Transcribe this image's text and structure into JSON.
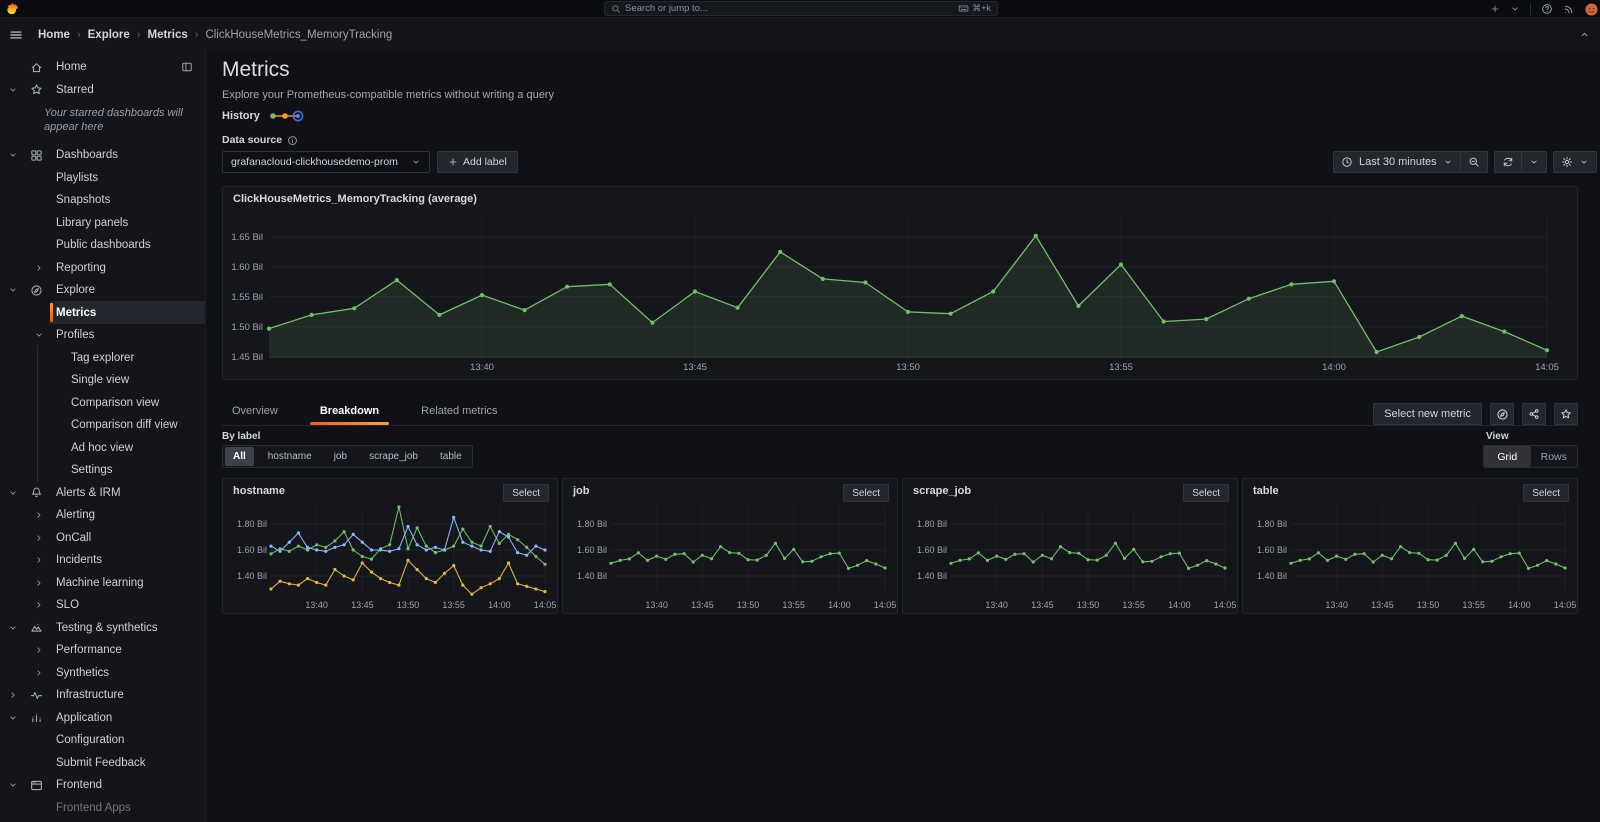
{
  "topbar": {
    "search_placeholder": "Search or jump to...",
    "shortcut": "⌘+k"
  },
  "breadcrumb": {
    "items": [
      "Home",
      "Explore",
      "Metrics"
    ],
    "current": "ClickHouseMetrics_MemoryTracking"
  },
  "sidebar": {
    "items": [
      {
        "label": "Home",
        "level": 0,
        "icon": "home",
        "trailing": "dock"
      },
      {
        "label": "Starred",
        "level": 0,
        "icon": "star",
        "chevron": "down"
      },
      {
        "type": "note",
        "text": "Your starred dashboards will appear here"
      },
      {
        "label": "Dashboards",
        "level": 0,
        "icon": "apps",
        "chevron": "down"
      },
      {
        "label": "Playlists",
        "level": 1
      },
      {
        "label": "Snapshots",
        "level": 1
      },
      {
        "label": "Library panels",
        "level": 1
      },
      {
        "label": "Public dashboards",
        "level": 1
      },
      {
        "label": "Reporting",
        "level": 1,
        "chevron": "right"
      },
      {
        "label": "Explore",
        "level": 0,
        "icon": "compass",
        "chevron": "down"
      },
      {
        "label": "Metrics",
        "level": 1,
        "selected": true
      },
      {
        "label": "Profiles",
        "level": 1,
        "chevron": "down"
      },
      {
        "label": "Tag explorer",
        "level": 2
      },
      {
        "label": "Single view",
        "level": 2
      },
      {
        "label": "Comparison view",
        "level": 2
      },
      {
        "label": "Comparison diff view",
        "level": 2
      },
      {
        "label": "Ad hoc view",
        "level": 2
      },
      {
        "label": "Settings",
        "level": 2
      },
      {
        "label": "Alerts & IRM",
        "level": 0,
        "icon": "bell",
        "chevron": "down"
      },
      {
        "label": "Alerting",
        "level": 1,
        "chevron": "right"
      },
      {
        "label": "OnCall",
        "level": 1,
        "chevron": "right"
      },
      {
        "label": "Incidents",
        "level": 1,
        "chevron": "right"
      },
      {
        "label": "Machine learning",
        "level": 1,
        "chevron": "right"
      },
      {
        "label": "SLO",
        "level": 1,
        "chevron": "right"
      },
      {
        "label": "Testing & synthetics",
        "level": 0,
        "icon": "mountain",
        "chevron": "down"
      },
      {
        "label": "Performance",
        "level": 1,
        "chevron": "right"
      },
      {
        "label": "Synthetics",
        "level": 1,
        "chevron": "right"
      },
      {
        "label": "Infrastructure",
        "level": 0,
        "icon": "pulse",
        "chevron": "right"
      },
      {
        "label": "Application",
        "level": 0,
        "icon": "bars",
        "chevron": "down"
      },
      {
        "label": "Configuration",
        "level": 1
      },
      {
        "label": "Submit Feedback",
        "level": 1
      },
      {
        "label": "Frontend",
        "level": 0,
        "icon": "browser",
        "chevron": "down"
      },
      {
        "label": "Frontend Apps",
        "level": 1,
        "dimmed": true
      }
    ]
  },
  "header": {
    "title": "Metrics",
    "subtitle": "Explore your Prometheus-compatible metrics without writing a query",
    "history_label": "History"
  },
  "datasource": {
    "label": "Data source",
    "value": "grafanacloud-clickhousedemo-prom",
    "add_label": "Add label"
  },
  "timebar": {
    "range": "Last 30 minutes"
  },
  "tabs": {
    "items": [
      "Overview",
      "Breakdown",
      "Related metrics"
    ],
    "active": "Breakdown",
    "select_new_metric": "Select new metric"
  },
  "bylabel": {
    "label": "By label",
    "options": [
      "All",
      "hostname",
      "job",
      "scrape_job",
      "table"
    ],
    "selected": "All",
    "view_label": "View",
    "view_options": [
      "Grid",
      "Rows"
    ],
    "view_selected": "Grid"
  },
  "panels": {
    "select_label": "Select"
  },
  "colors": {
    "accent_orange": "#ed5b28",
    "green": "#73bf69",
    "blue": "#8ab8ff",
    "yellow": "#eab839"
  },
  "chart_data": [
    {
      "id": "main",
      "type": "line",
      "title": "ClickHouseMetrics_MemoryTracking (average)",
      "x_tick_labels": [
        "13:40",
        "13:45",
        "13:50",
        "13:55",
        "14:00",
        "14:05"
      ],
      "x_tick_indices": [
        5,
        10,
        15,
        20,
        25,
        30
      ],
      "x_start": "13:35",
      "x_step_minutes": 1,
      "y_ticks": [
        {
          "v": 1.45,
          "label": "1.45 Bil"
        },
        {
          "v": 1.5,
          "label": "1.50 Bil"
        },
        {
          "v": 1.55,
          "label": "1.55 Bil"
        },
        {
          "v": 1.6,
          "label": "1.60 Bil"
        },
        {
          "v": 1.65,
          "label": "1.65 Bil"
        }
      ],
      "ylim": [
        1.448,
        1.69
      ],
      "unit": "Bil",
      "series": [
        {
          "name": "average",
          "color": "#73bf69",
          "fill": true,
          "values": [
            1.497,
            1.52,
            1.531,
            1.578,
            1.52,
            1.553,
            1.528,
            1.567,
            1.571,
            1.507,
            1.559,
            1.532,
            1.625,
            1.58,
            1.574,
            1.525,
            1.522,
            1.559,
            1.652,
            1.535,
            1.604,
            1.509,
            1.513,
            1.547,
            1.571,
            1.576,
            1.458,
            1.483,
            1.518,
            1.492,
            1.461
          ]
        }
      ]
    },
    {
      "id": "hostname",
      "type": "line",
      "title": "hostname",
      "x_tick_labels": [
        "13:40",
        "13:45",
        "13:50",
        "13:55",
        "14:00",
        "14:05"
      ],
      "x_tick_indices": [
        5,
        10,
        15,
        20,
        25,
        30
      ],
      "y_ticks": [
        {
          "v": 1.4,
          "label": "1.40 Bil"
        },
        {
          "v": 1.6,
          "label": "1.60 Bil"
        },
        {
          "v": 1.8,
          "label": "1.80 Bil"
        }
      ],
      "ylim": [
        1.269,
        1.938
      ],
      "unit": "Bil",
      "series": [
        {
          "name": "series-green",
          "color": "#73bf69",
          "values": [
            1.57,
            1.61,
            1.59,
            1.63,
            1.6,
            1.64,
            1.62,
            1.67,
            1.74,
            1.6,
            1.55,
            1.53,
            1.61,
            1.64,
            1.93,
            1.61,
            1.77,
            1.63,
            1.58,
            1.6,
            1.63,
            1.76,
            1.66,
            1.63,
            1.78,
            1.65,
            1.72,
            1.68,
            1.62,
            1.55,
            1.49
          ]
        },
        {
          "name": "series-blue",
          "color": "#8ab8ff",
          "values": [
            1.63,
            1.59,
            1.66,
            1.73,
            1.62,
            1.6,
            1.59,
            1.62,
            1.64,
            1.72,
            1.66,
            1.6,
            1.6,
            1.59,
            1.61,
            1.78,
            1.64,
            1.6,
            1.62,
            1.6,
            1.85,
            1.66,
            1.63,
            1.6,
            1.59,
            1.74,
            1.7,
            1.58,
            1.56,
            1.63,
            1.6
          ]
        },
        {
          "name": "series-yellow",
          "color": "#eab839",
          "values": [
            1.3,
            1.36,
            1.34,
            1.33,
            1.38,
            1.35,
            1.33,
            1.45,
            1.4,
            1.37,
            1.5,
            1.43,
            1.38,
            1.35,
            1.33,
            1.52,
            1.45,
            1.38,
            1.35,
            1.42,
            1.48,
            1.33,
            1.26,
            1.31,
            1.34,
            1.38,
            1.5,
            1.34,
            1.32,
            1.3,
            1.28
          ]
        }
      ]
    },
    {
      "id": "job",
      "type": "line",
      "title": "job",
      "x_tick_labels": [
        "13:40",
        "13:45",
        "13:50",
        "13:55",
        "14:00",
        "14:05"
      ],
      "x_tick_indices": [
        5,
        10,
        15,
        20,
        25,
        30
      ],
      "y_ticks": [
        {
          "v": 1.4,
          "label": "1.40 Bil"
        },
        {
          "v": 1.6,
          "label": "1.60 Bil"
        },
        {
          "v": 1.8,
          "label": "1.80 Bil"
        }
      ],
      "ylim": [
        1.269,
        1.938
      ],
      "unit": "Bil",
      "series": [
        {
          "name": "series-green",
          "color": "#73bf69",
          "values": [
            1.497,
            1.52,
            1.531,
            1.578,
            1.52,
            1.553,
            1.528,
            1.567,
            1.571,
            1.507,
            1.559,
            1.532,
            1.625,
            1.58,
            1.574,
            1.525,
            1.522,
            1.559,
            1.652,
            1.535,
            1.604,
            1.509,
            1.513,
            1.547,
            1.571,
            1.576,
            1.458,
            1.483,
            1.518,
            1.492,
            1.461
          ]
        }
      ]
    },
    {
      "id": "scrape_job",
      "type": "line",
      "title": "scrape_job",
      "x_tick_labels": [
        "13:40",
        "13:45",
        "13:50",
        "13:55",
        "14:00",
        "14:05"
      ],
      "x_tick_indices": [
        5,
        10,
        15,
        20,
        25,
        30
      ],
      "y_ticks": [
        {
          "v": 1.4,
          "label": "1.40 Bil"
        },
        {
          "v": 1.6,
          "label": "1.60 Bil"
        },
        {
          "v": 1.8,
          "label": "1.80 Bil"
        }
      ],
      "ylim": [
        1.269,
        1.938
      ],
      "unit": "Bil",
      "series": [
        {
          "name": "series-green",
          "color": "#73bf69",
          "values": [
            1.497,
            1.52,
            1.531,
            1.578,
            1.52,
            1.553,
            1.528,
            1.567,
            1.571,
            1.507,
            1.559,
            1.532,
            1.625,
            1.58,
            1.574,
            1.525,
            1.522,
            1.559,
            1.652,
            1.535,
            1.604,
            1.509,
            1.513,
            1.547,
            1.571,
            1.576,
            1.458,
            1.483,
            1.518,
            1.492,
            1.461
          ]
        }
      ]
    },
    {
      "id": "table",
      "type": "line",
      "title": "table",
      "x_tick_labels": [
        "13:40",
        "13:45",
        "13:50",
        "13:55",
        "14:00",
        "14:05"
      ],
      "x_tick_indices": [
        5,
        10,
        15,
        20,
        25,
        30
      ],
      "y_ticks": [
        {
          "v": 1.4,
          "label": "1.40 Bil"
        },
        {
          "v": 1.6,
          "label": "1.60 Bil"
        },
        {
          "v": 1.8,
          "label": "1.80 Bil"
        }
      ],
      "ylim": [
        1.269,
        1.938
      ],
      "unit": "Bil",
      "series": [
        {
          "name": "series-green",
          "color": "#73bf69",
          "values": [
            1.497,
            1.52,
            1.531,
            1.578,
            1.52,
            1.553,
            1.528,
            1.567,
            1.571,
            1.507,
            1.559,
            1.532,
            1.625,
            1.58,
            1.574,
            1.525,
            1.522,
            1.559,
            1.652,
            1.535,
            1.604,
            1.509,
            1.513,
            1.547,
            1.571,
            1.576,
            1.458,
            1.483,
            1.518,
            1.492,
            1.461
          ]
        }
      ]
    }
  ]
}
